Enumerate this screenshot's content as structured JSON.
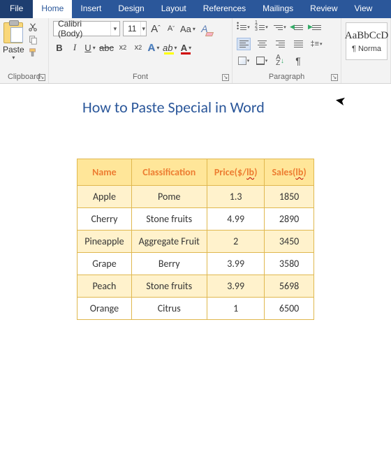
{
  "tabs": {
    "file": "File",
    "home": "Home",
    "insert": "Insert",
    "design": "Design",
    "layout": "Layout",
    "references": "References",
    "mailings": "Mailings",
    "review": "Review",
    "view": "View"
  },
  "ribbon": {
    "clipboard": {
      "label": "Clipboard",
      "paste": "Paste"
    },
    "font": {
      "label": "Font",
      "name": "Calibri (Body)",
      "size": "11"
    },
    "paragraph": {
      "label": "Paragraph"
    },
    "styles": {
      "sample": "AaBbCcD",
      "name": "¶ Norma"
    }
  },
  "document": {
    "title": "How to Paste Special in Word",
    "table": {
      "headers": [
        "Name",
        "Classification",
        "Price($/lb)",
        "Sales(lb)"
      ],
      "header_wavy": [
        false,
        false,
        "lb",
        "lb"
      ],
      "rows": [
        [
          "Apple",
          "Pome",
          "1.3",
          "1850"
        ],
        [
          "Cherry",
          "Stone fruits",
          "4.99",
          "2890"
        ],
        [
          "Pineapple",
          "Aggregate Fruit",
          "2",
          "3450"
        ],
        [
          "Grape",
          "Berry",
          "3.99",
          "3580"
        ],
        [
          "Peach",
          "Stone fruits",
          "3.99",
          "5698"
        ],
        [
          "Orange",
          "Citrus",
          "1",
          "6500"
        ]
      ]
    }
  }
}
